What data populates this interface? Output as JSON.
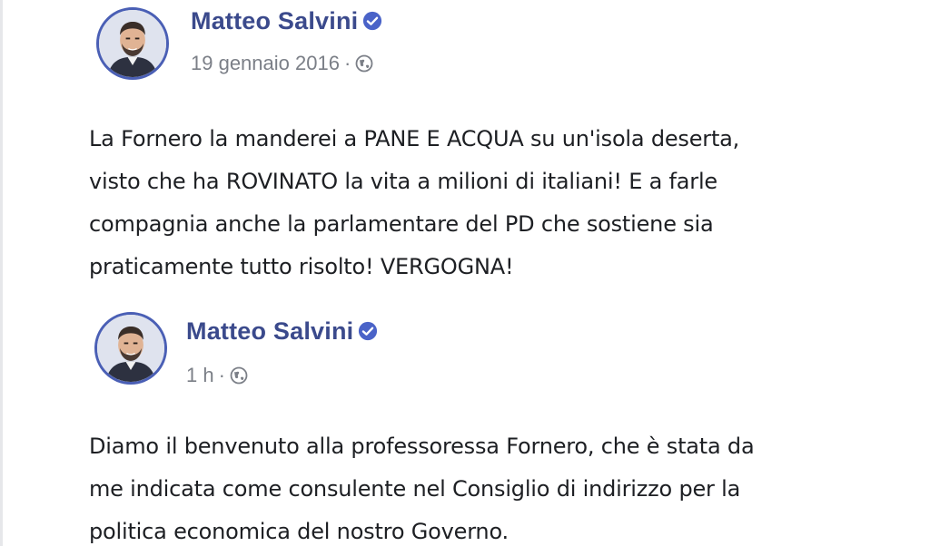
{
  "posts": [
    {
      "author": "Matteo Salvini",
      "timestamp": "19 gennaio 2016",
      "separator": "·",
      "privacy_icon": "globe-icon",
      "verified_icon": "verified-badge-icon",
      "lines": [
        "La Fornero la manderei a PANE E ACQUA su un'isola deserta,",
        "visto che ha ROVINATO la vita a milioni di italiani!  E a farle",
        "compagnia anche la parlamentare del PD che sostiene sia",
        "praticamente tutto risolto! VERGOGNA!"
      ]
    },
    {
      "author": "Matteo Salvini",
      "timestamp": "1 h",
      "separator": "·",
      "privacy_icon": "globe-icon",
      "verified_icon": "verified-badge-icon",
      "lines": [
        "Diamo il benvenuto alla professoressa Fornero, che è stata da",
        "me indicata come consulente nel Consiglio di indirizzo per la",
        "politica economica del nostro Governo."
      ]
    }
  ],
  "colors": {
    "author": "#3b4a8c",
    "verified": "#4a63c8",
    "meta": "#7b7f87",
    "text": "#1d1f23",
    "avatar_ring": "#4a5fb5"
  }
}
